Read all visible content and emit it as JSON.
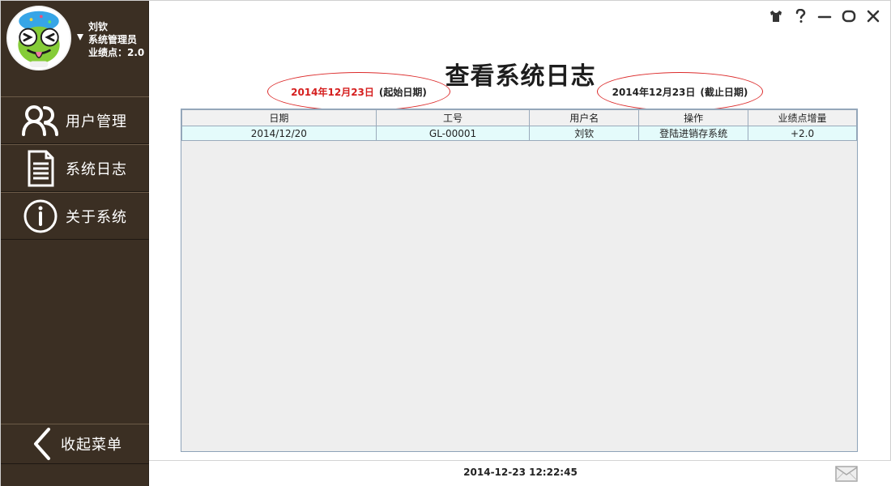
{
  "sidebar": {
    "profile": {
      "name": "刘钦",
      "role": "系统管理员",
      "points": "业绩点：2.0",
      "avatar_icon": "frog-avatar-icon"
    },
    "items": [
      {
        "label": "用户管理",
        "icon": "users-icon"
      },
      {
        "label": "系统日志",
        "icon": "document-icon"
      },
      {
        "label": "关于系统",
        "icon": "info-icon"
      }
    ],
    "collapse_label": "收起菜单",
    "collapse_icon": "chevron-left-icon"
  },
  "header": {
    "title": "查看系统日志",
    "window_controls": [
      "shirt-icon",
      "help-icon",
      "minimize-icon",
      "maximize-icon",
      "close-icon"
    ]
  },
  "filters": {
    "start_date": "2014年12月23日",
    "start_suffix": "(起始日期)",
    "end_date": "2014年12月23日",
    "end_suffix": "(截止日期)"
  },
  "table": {
    "columns": [
      "日期",
      "工号",
      "用户名",
      "操作",
      "业绩点增量"
    ],
    "rows": [
      [
        "2014/12/20",
        "GL-00001",
        "刘钦",
        "登陆进销存系统",
        "+2.0"
      ]
    ]
  },
  "status": {
    "timestamp": "2014-12-23 12:22:45",
    "mail_icon": "mail-icon"
  },
  "colors": {
    "sidebar_bg": "#3b2f23",
    "accent_red": "#d51f1f",
    "table_row_bg": "#e4fbfb",
    "table_bg": "#eeeeee"
  }
}
